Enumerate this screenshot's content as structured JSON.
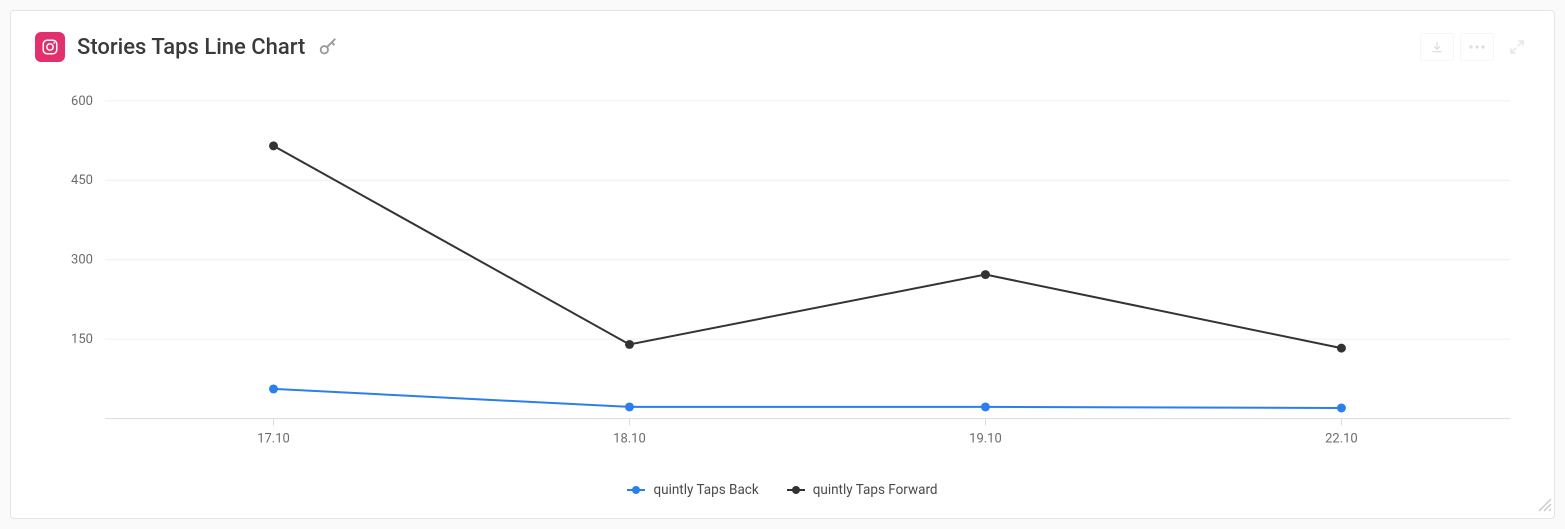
{
  "header": {
    "title": "Stories Taps Line Chart"
  },
  "chart_data": {
    "type": "line",
    "categories": [
      "17.10",
      "18.10",
      "19.10",
      "22.10"
    ],
    "series": [
      {
        "name": "quintly Taps Back",
        "color": "#2a7fec",
        "values": [
          56,
          22,
          22,
          20
        ]
      },
      {
        "name": "quintly Taps Forward",
        "color": "#333333",
        "values": [
          515,
          140,
          272,
          133
        ]
      }
    ],
    "ylim": [
      0,
      600
    ],
    "yticks": [
      150,
      300,
      450,
      600
    ],
    "xlabel": "",
    "ylabel": "",
    "grid": true
  }
}
